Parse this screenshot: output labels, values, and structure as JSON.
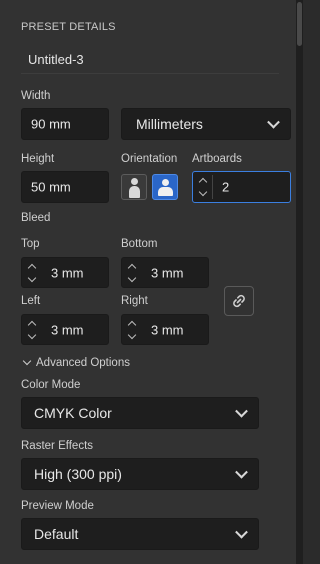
{
  "section": {
    "title": "PRESET DETAILS"
  },
  "preset_name": "Untitled-3",
  "width": {
    "label": "Width",
    "value": "90 mm"
  },
  "units": {
    "value": "Millimeters"
  },
  "height": {
    "label": "Height",
    "value": "50 mm"
  },
  "orientation": {
    "label": "Orientation"
  },
  "artboards": {
    "label": "Artboards",
    "value": "2"
  },
  "bleed": {
    "label": "Bleed",
    "top": {
      "label": "Top",
      "value": "3 mm"
    },
    "bottom": {
      "label": "Bottom",
      "value": "3 mm"
    },
    "left": {
      "label": "Left",
      "value": "3 mm"
    },
    "right": {
      "label": "Right",
      "value": "3 mm"
    }
  },
  "advanced": {
    "label": "Advanced Options"
  },
  "color_mode": {
    "label": "Color Mode",
    "value": "CMYK Color"
  },
  "raster_effects": {
    "label": "Raster Effects",
    "value": "High (300 ppi)"
  },
  "preview_mode": {
    "label": "Preview Mode",
    "value": "Default"
  },
  "colors": {
    "accent": "#3b7fe0",
    "selected_orientation": "#2a66c8"
  }
}
